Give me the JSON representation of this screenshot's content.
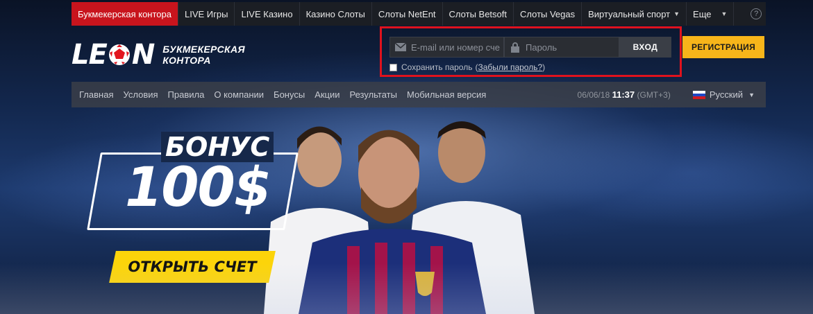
{
  "top_nav": {
    "items": [
      {
        "label": "Букмекерская контора",
        "active": true
      },
      {
        "label": "LIVE Игры"
      },
      {
        "label": "LIVE Казино"
      },
      {
        "label": "Казино Слоты"
      },
      {
        "label": "Слоты NetEnt"
      },
      {
        "label": "Слоты Betsoft"
      },
      {
        "label": "Слоты Vegas"
      },
      {
        "label": "Виртуальный спорт"
      },
      {
        "label": "Еще"
      }
    ],
    "help_label": "?"
  },
  "logo": {
    "word_left": "LE",
    "word_right": "N",
    "subtitle_line1": "БУКМЕКЕРСКАЯ",
    "subtitle_line2": "КОНТОРА"
  },
  "login": {
    "email_placeholder": "E-mail или номер сче",
    "password_placeholder": "Пароль",
    "login_button": "ВХОД",
    "remember_label": "Сохранить пароль",
    "forgot_open": "(",
    "forgot_label": "Забыли пароль?",
    "forgot_close": ")"
  },
  "register_button": "РЕГИСТРАЦИЯ",
  "sub_nav": {
    "items": [
      "Главная",
      "Условия",
      "Правила",
      "О компании",
      "Бонусы",
      "Акции",
      "Результаты",
      "Мобильная версия"
    ],
    "date": "06/06/18",
    "time": "11:37",
    "timezone": "(GMT+3)",
    "language": "Русский"
  },
  "banner": {
    "bonus_label": "БОНУС",
    "bonus_amount": "100$",
    "cta_label": "ОТКРЫТЬ СЧЕТ"
  },
  "colors": {
    "accent_red": "#c8141d",
    "highlight_border": "#e0121d",
    "register_yellow": "#f7b51a",
    "cta_yellow": "#fcd40a"
  }
}
